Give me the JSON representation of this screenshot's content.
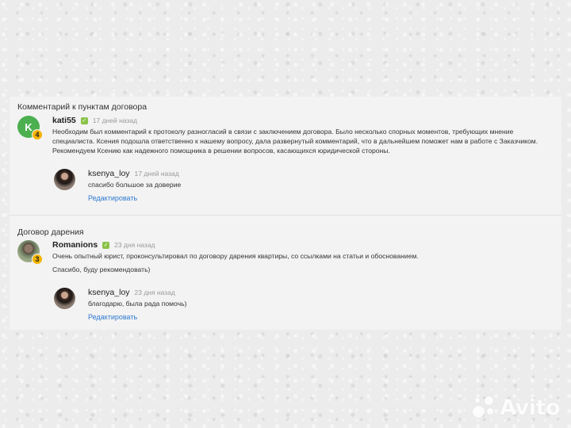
{
  "sections": [
    {
      "title": "Комментарий к пунктам договора",
      "comment": {
        "avatar_letter": "K",
        "level": "4",
        "user": "kati55",
        "time": "17 дней назад",
        "text": "Необходим был комментарий к протоколу разногласий в связи с заключением договора. Было несколько спорных моментов, требующих мнение специалиста. Ксения подошла ответственно к нашему вопросу, дала развернутый комментарий, что в дальнейшем поможет нам в работе с Заказчиком. Рекомендуем Ксению как надежного помощника в решении вопросов, касающихся юридической стороны."
      },
      "reply": {
        "user": "ksenya_loy",
        "time": "17 дней назад",
        "text": "спасибо большое за доверие",
        "edit_label": "Редактировать"
      }
    },
    {
      "title": "Договор дарения",
      "comment": {
        "level": "3",
        "user": "Romanions",
        "time": "23 дня назад",
        "text_line1": "Очень опытный юрист, проконсультировал по договору дарения квартиры, со ссылками на статьи и обоснованием.",
        "text_line2": "Спасибо, буду рекомендовать)"
      },
      "reply": {
        "user": "ksenya_loy",
        "time": "23 дня назад",
        "text": "благодарю, была рада помочь)",
        "edit_label": "Редактировать"
      }
    }
  ],
  "watermark": {
    "text": "Avito",
    "icon": "avito-logo-icon"
  },
  "colors": {
    "accent_link": "#2f7ad1",
    "avatar_green": "#4caf50",
    "badge_yellow": "#f5b400",
    "verified_green": "#8bc34a"
  }
}
